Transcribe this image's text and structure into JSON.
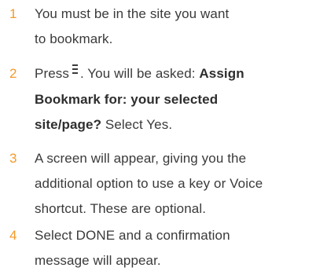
{
  "steps": [
    {
      "number": "1",
      "line1": "You must be in the site you want",
      "line2": "to bookmark."
    },
    {
      "number": "2",
      "press": "Press",
      "icon": "menu-icon",
      "after_icon": ". You will be asked:",
      "bold_line1_tail": "Assign",
      "bold_line2": "Bookmark for: your selected",
      "bold_line3": "site/page?",
      "after_bold": "Select Yes."
    },
    {
      "number": "3",
      "line1": "A screen will appear, giving you the",
      "line2": "additional option to use a key or Voice",
      "line3": "shortcut. These are optional."
    },
    {
      "number": "4",
      "line1": "Select DONE and a confirmation",
      "line2": "message will appear."
    }
  ],
  "colors": {
    "number": "#f39a2a",
    "text": "#3a3a3a"
  }
}
